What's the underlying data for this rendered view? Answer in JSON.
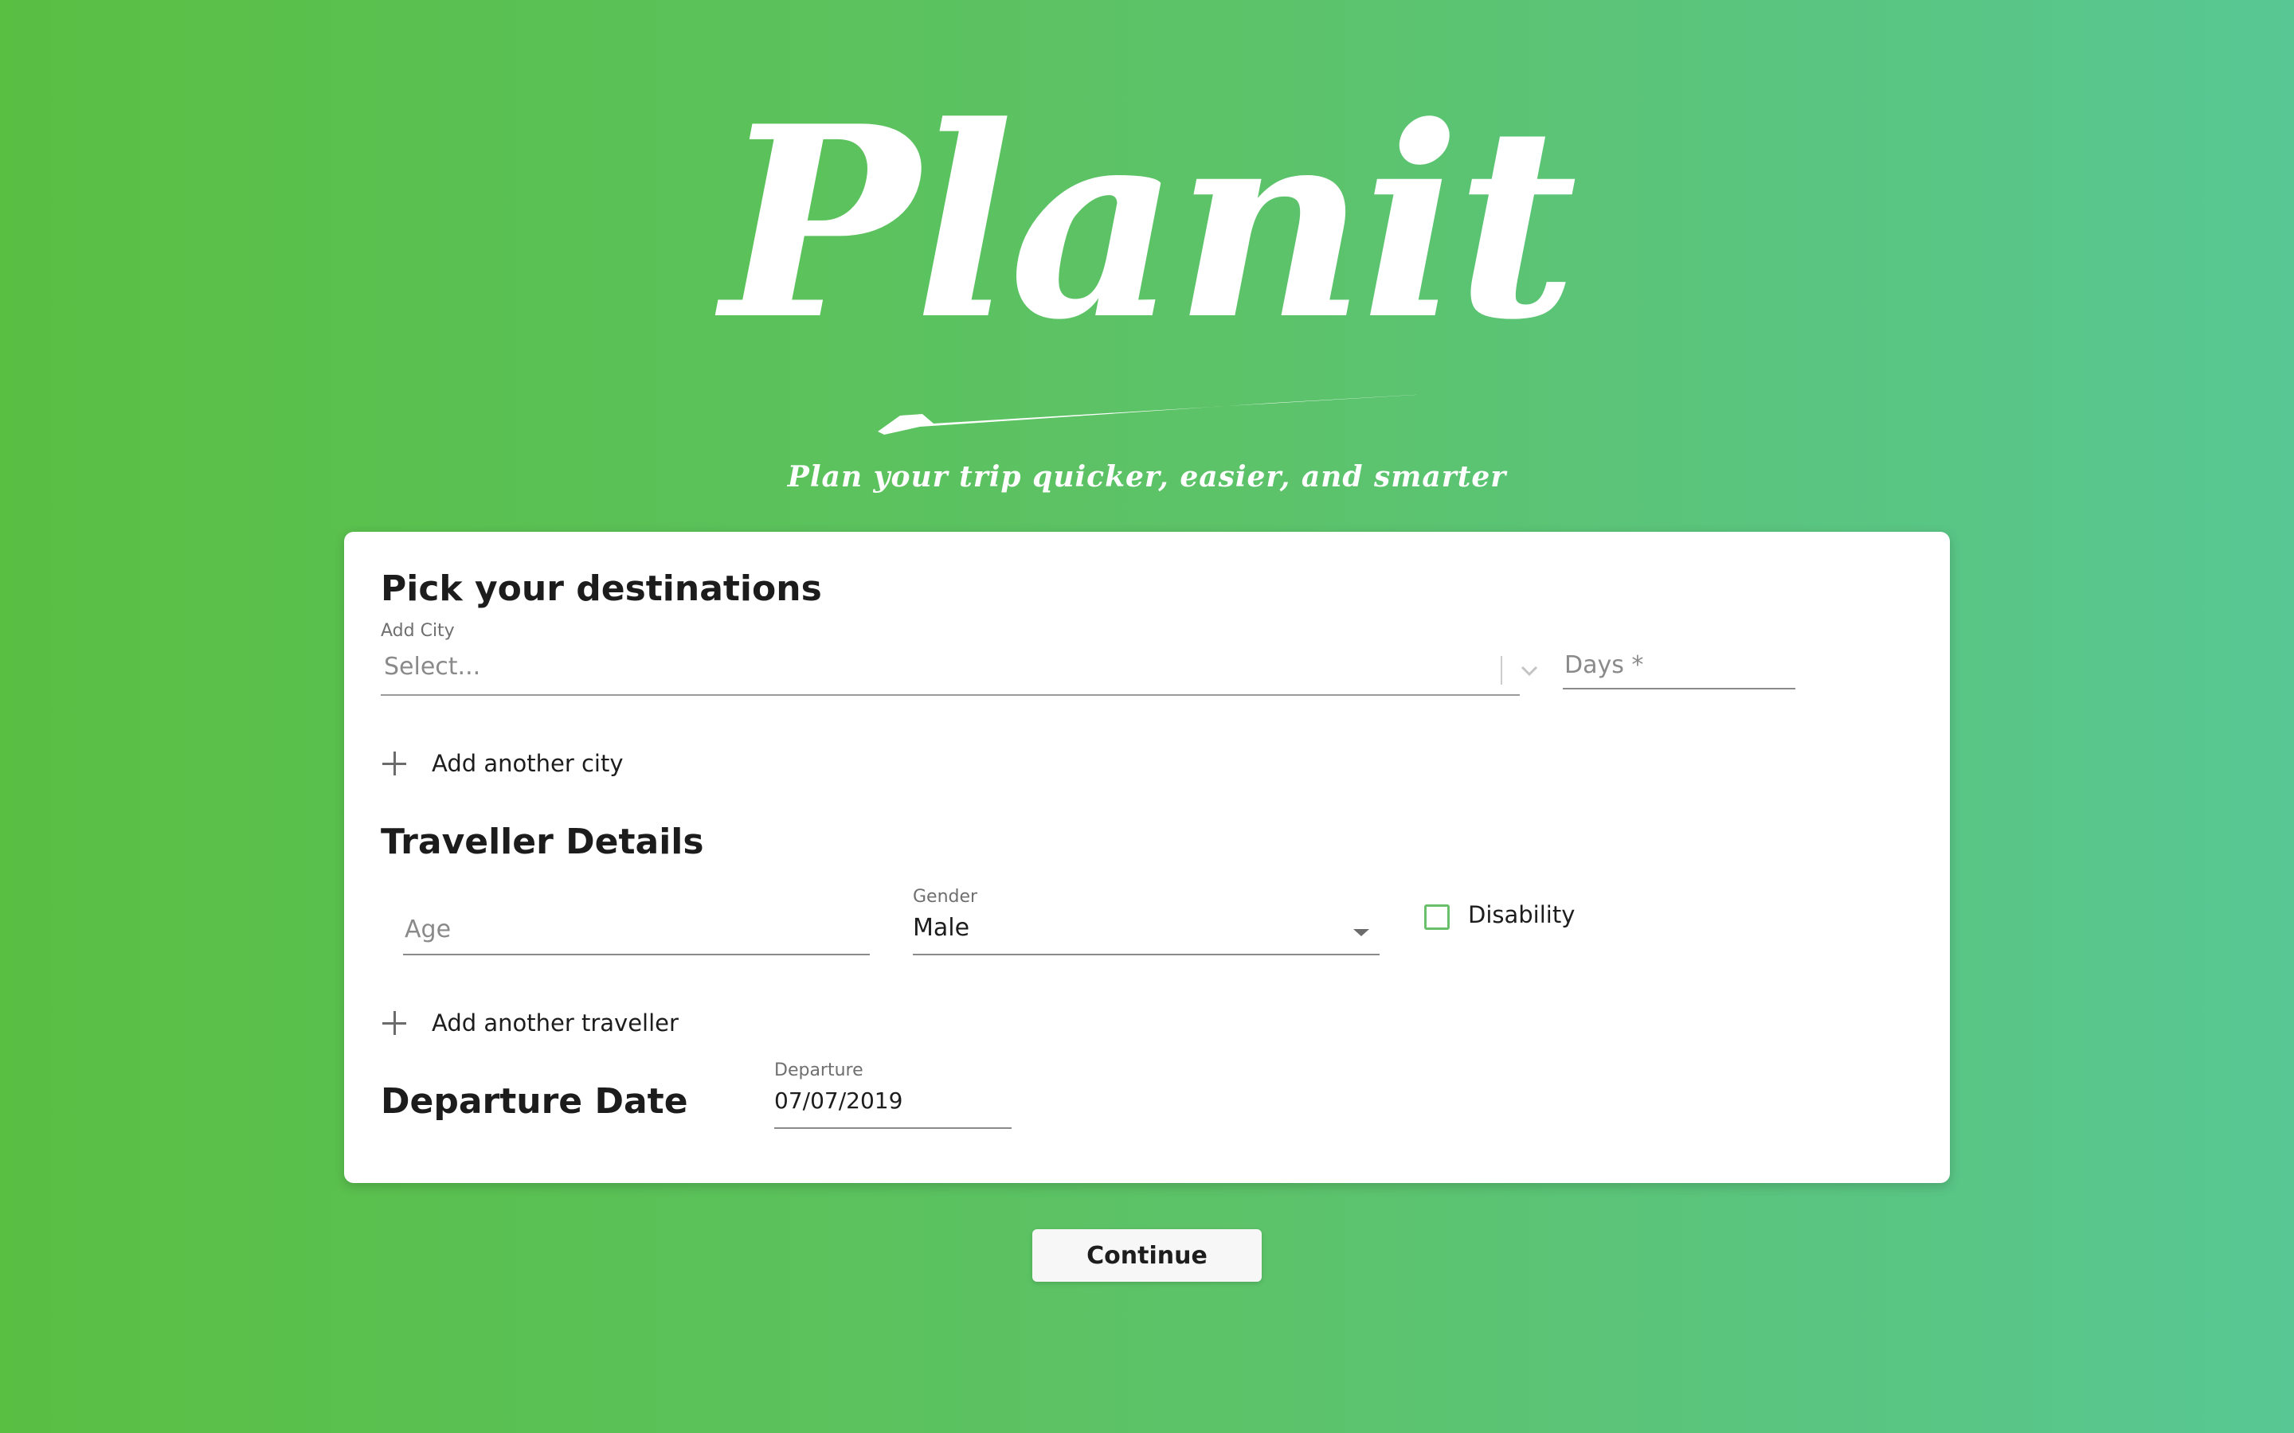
{
  "brand": {
    "logo_text": "Planit",
    "tagline": "Plan your trip quicker, easier, and smarter"
  },
  "destinations": {
    "title": "Pick your destinations",
    "city_label": "Add City",
    "city_placeholder": "Select...",
    "days_placeholder": "Days *",
    "add_city_label": "Add another city"
  },
  "traveller": {
    "title": "Traveller Details",
    "age_placeholder": "Age",
    "gender_label": "Gender",
    "gender_value": "Male",
    "disability_label": "Disability",
    "disability_checked": false,
    "add_traveller_label": "Add another traveller"
  },
  "departure": {
    "title": "Departure Date",
    "label": "Departure",
    "value": "07/07/2019"
  },
  "actions": {
    "continue_label": "Continue"
  },
  "colors": {
    "background_left": "#59bf43",
    "background_right": "#58c793",
    "checkbox_border": "#6abf6a"
  }
}
